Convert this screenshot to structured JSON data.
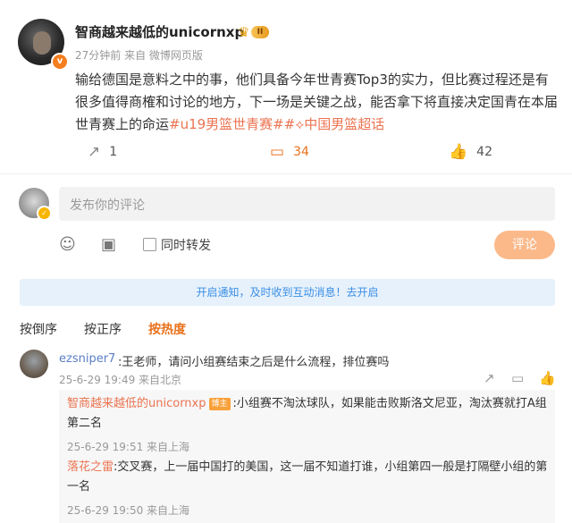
{
  "post": {
    "username": "智商越来越低的unicornxp",
    "level_badge": "II",
    "vip_badge": "v",
    "meta": "27分钟前  来自 微博网页版",
    "content_text": "输给德国是意料之中的事，他们具备今年世青赛Top3的实力，但比赛过程还是有很多值得商榷和讨论的地方，下一场是关键之战，能否拿下将直接决定国青在本届世青赛上的命运",
    "tag1": "#u19男篮世青赛#",
    "tag2": "#⟡中国男篮超话",
    "actions": {
      "repost_count": "1",
      "comment_count": "34",
      "like_count": "42"
    }
  },
  "composer": {
    "placeholder": "发布你的评论",
    "repost_label": "同时转发",
    "submit_label": "评论"
  },
  "notice": "开启通知，及时收到互动消息！去开启",
  "sort": {
    "desc": "按倒序",
    "asc": "按正序",
    "hot": "按热度"
  },
  "comments": [
    {
      "name": "ezsniper7",
      "text": ":王老师，请问小组赛结束之后是什么流程，排位赛吗",
      "meta": "25-6-29 19:49 来自北京",
      "replies": [
        {
          "name": "智商越来越低的unicornxp",
          "author_tag": "博主",
          "text_line1": ":小组赛不淘汰球队，如果能击败斯洛文尼亚，淘汰赛就打A组",
          "text_line2": "第二名",
          "meta": "25-6-29 19:51  来自上海"
        },
        {
          "name": "落花之雷",
          "text_line1": ":交叉赛，上一届中国打的美国，这一届不知道打谁，小组第四一般是打隔壁小组的第",
          "text_line2": "一名",
          "meta": "25-6-29 19:50  来自上海"
        }
      ]
    }
  ],
  "colors": {
    "accent": "#e8721c",
    "tag": "#eb7350",
    "link_blue": "#5b7fc7",
    "notice_bg": "#e6f1fb"
  }
}
